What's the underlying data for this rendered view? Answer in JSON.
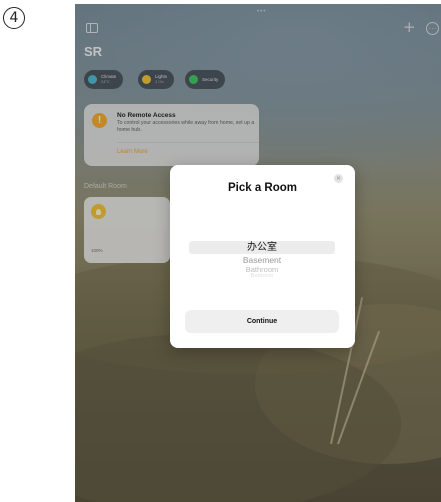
{
  "step_badge": "4",
  "header": {
    "home_name": "SR",
    "top_indicator": "•••"
  },
  "chips": [
    {
      "label": "Climate",
      "sub": "24°C",
      "color": "#3db9d3"
    },
    {
      "label": "Lights",
      "sub": "1 On",
      "color": "#f3c12a"
    },
    {
      "label": "Security",
      "sub": "",
      "color": "#34c759"
    }
  ],
  "alert": {
    "title": "No Remote Access",
    "body": "To control your accessories while away from home, set up a home hub.",
    "link": "Learn More"
  },
  "room_section": {
    "label": "Default Room"
  },
  "accessory": {
    "name": "",
    "status": "100%"
  },
  "dialog": {
    "title": "Pick a Room",
    "close_glyph": "×",
    "rooms": [
      "办公室",
      "Basement",
      "Bathroom",
      "Bedroom"
    ],
    "continue_label": "Continue"
  },
  "colors": {
    "accent": "#f0a022",
    "alert_icon": "#f5a623"
  }
}
